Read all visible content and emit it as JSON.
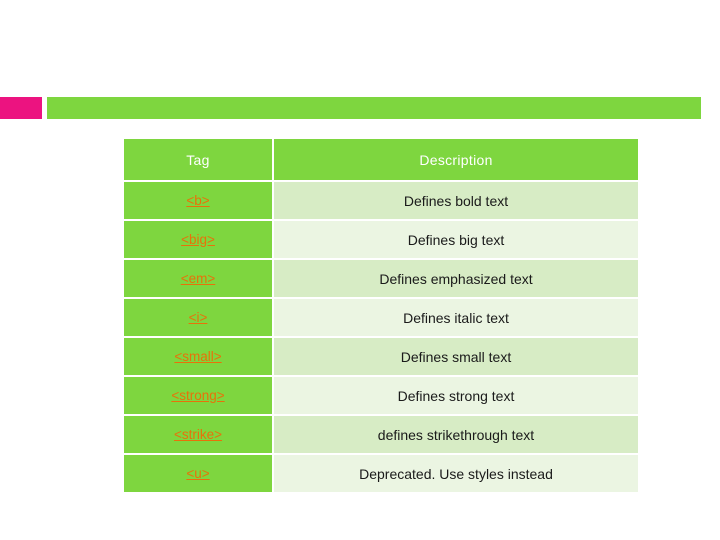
{
  "slide": {
    "banner": {
      "accent_block_color": "#ec1380",
      "bar_color": "#7ed63f"
    },
    "theme": {
      "header_green": "#7ed63f",
      "row_dark": "#d7ecc5",
      "row_light": "#ebf5e2",
      "link_orange": "#e8710a",
      "header_text": "#ffffff",
      "body_text": "#1a1a1a"
    }
  },
  "table": {
    "headers": [
      "Tag",
      "Description"
    ],
    "rows": [
      {
        "tag": "<b>",
        "description": "Defines bold text"
      },
      {
        "tag": "<big>",
        "description": "Defines big text"
      },
      {
        "tag": "<em>",
        "description": "Defines emphasized text"
      },
      {
        "tag": "<i>",
        "description": "Defines italic text"
      },
      {
        "tag": "<small>",
        "description": "Defines small text"
      },
      {
        "tag": "<strong>",
        "description": "Defines strong text"
      },
      {
        "tag": "<strike>",
        "description": "defines strikethrough text"
      },
      {
        "tag": "<u>",
        "description": "Deprecated. Use styles instead"
      }
    ]
  }
}
